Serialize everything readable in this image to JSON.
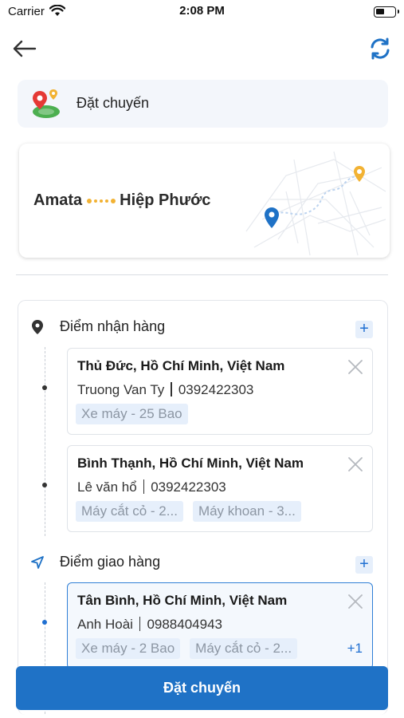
{
  "status_bar": {
    "carrier": "Carrier",
    "time": "2:08 PM",
    "battery_level": 0.45
  },
  "nav": {
    "back_icon": "arrow-left-icon",
    "refresh_icon": "refresh-icon"
  },
  "service": {
    "label": "Đặt chuyến",
    "icon": "map-pin-icon"
  },
  "route": {
    "from": "Amata",
    "to": "Hiệp Phước",
    "accent": "#f2b233"
  },
  "pickup": {
    "title": "Điểm nhận hàng",
    "add_label": "+",
    "stops": [
      {
        "address": "Thủ Đức, Hồ Chí Minh, Việt Nam",
        "name": "Truong Van Ty",
        "phone": "0392422303",
        "tags": [
          "Xe máy - 25 Bao"
        ]
      },
      {
        "address": "Bình Thạnh, Hồ Chí Minh, Việt Nam",
        "name": "Lê văn hổ",
        "phone": "0392422303",
        "tags": [
          "Máy cắt cỏ - 2...",
          "Máy khoan - 3..."
        ]
      }
    ]
  },
  "delivery": {
    "title": "Điểm giao hàng",
    "add_label": "+",
    "stops": [
      {
        "address": "Tân Bình, Hồ Chí Minh, Việt Nam",
        "name": "Anh Hoài",
        "phone": "0988404943",
        "tags": [
          "Xe máy - 2 Bao",
          "Máy cắt cỏ - 2..."
        ],
        "more": "+1"
      }
    ]
  },
  "submit_label": "Đặt chuyến",
  "colors": {
    "primary": "#1f72c6",
    "tag_bg": "#e6effb",
    "accent": "#f2b233"
  }
}
